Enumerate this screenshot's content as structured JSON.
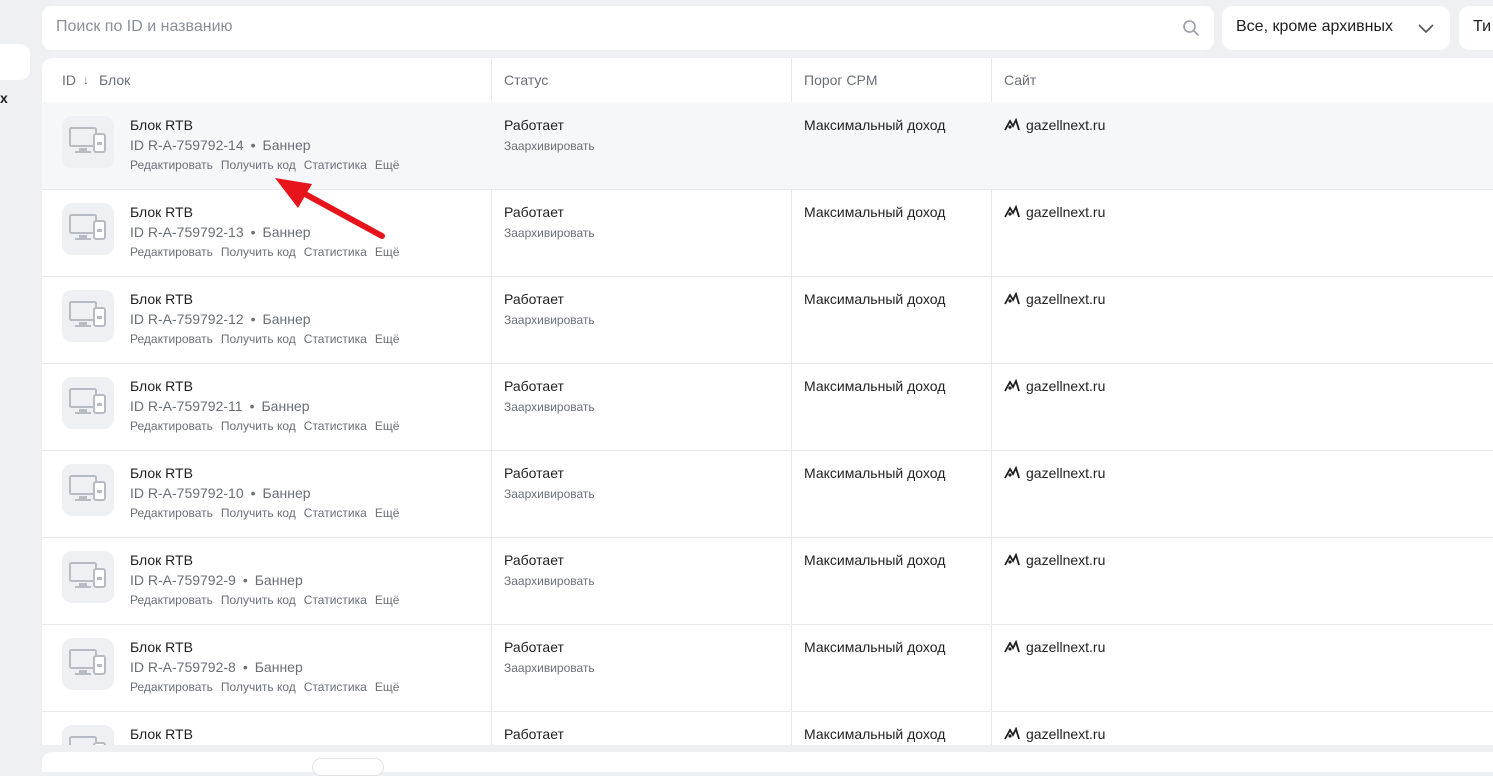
{
  "search": {
    "placeholder": "Поиск по ID и названию"
  },
  "filters": {
    "status_value": "Все, кроме архивных",
    "type_value": "Ти"
  },
  "sidebar": {
    "cut_text": "х"
  },
  "table": {
    "columns": {
      "id": "ID",
      "sort_arrow": "↓",
      "block": "Блок",
      "status": "Статус",
      "cpm": "Порог CPM",
      "site": "Сайт"
    },
    "rows": [
      {
        "title": "Блок RTB",
        "id": "ID R-A-759792-14",
        "format": "Баннер",
        "actions": [
          "Редактировать",
          "Получить код",
          "Статистика",
          "Ещё"
        ],
        "status": "Работает",
        "status_action": "Заархивировать",
        "cpm": "Максимальный доход",
        "site": "gazellnext.ru"
      },
      {
        "title": "Блок RTB",
        "id": "ID R-A-759792-13",
        "format": "Баннер",
        "actions": [
          "Редактировать",
          "Получить код",
          "Статистика",
          "Ещё"
        ],
        "status": "Работает",
        "status_action": "Заархивировать",
        "cpm": "Максимальный доход",
        "site": "gazellnext.ru"
      },
      {
        "title": "Блок RTB",
        "id": "ID R-A-759792-12",
        "format": "Баннер",
        "actions": [
          "Редактировать",
          "Получить код",
          "Статистика",
          "Ещё"
        ],
        "status": "Работает",
        "status_action": "Заархивировать",
        "cpm": "Максимальный доход",
        "site": "gazellnext.ru"
      },
      {
        "title": "Блок RTB",
        "id": "ID R-A-759792-11",
        "format": "Баннер",
        "actions": [
          "Редактировать",
          "Получить код",
          "Статистика",
          "Ещё"
        ],
        "status": "Работает",
        "status_action": "Заархивировать",
        "cpm": "Максимальный доход",
        "site": "gazellnext.ru"
      },
      {
        "title": "Блок RTB",
        "id": "ID R-A-759792-10",
        "format": "Баннер",
        "actions": [
          "Редактировать",
          "Получить код",
          "Статистика",
          "Ещё"
        ],
        "status": "Работает",
        "status_action": "Заархивировать",
        "cpm": "Максимальный доход",
        "site": "gazellnext.ru"
      },
      {
        "title": "Блок RTB",
        "id": "ID R-A-759792-9",
        "format": "Баннер",
        "actions": [
          "Редактировать",
          "Получить код",
          "Статистика",
          "Ещё"
        ],
        "status": "Работает",
        "status_action": "Заархивировать",
        "cpm": "Максимальный доход",
        "site": "gazellnext.ru"
      },
      {
        "title": "Блок RTB",
        "id": "ID R-A-759792-8",
        "format": "Баннер",
        "actions": [
          "Редактировать",
          "Получить код",
          "Статистика",
          "Ещё"
        ],
        "status": "Работает",
        "status_action": "Заархивировать",
        "cpm": "Максимальный доход",
        "site": "gazellnext.ru"
      },
      {
        "title": "Блок RTB",
        "id": "",
        "format": "",
        "actions": [],
        "status": "Работает",
        "status_action": "",
        "cpm": "Максимальный доход",
        "site": "gazellnext.ru"
      }
    ]
  },
  "colors": {
    "page_bg": "#eef0f4",
    "annotation_arrow": "#e8141c"
  }
}
